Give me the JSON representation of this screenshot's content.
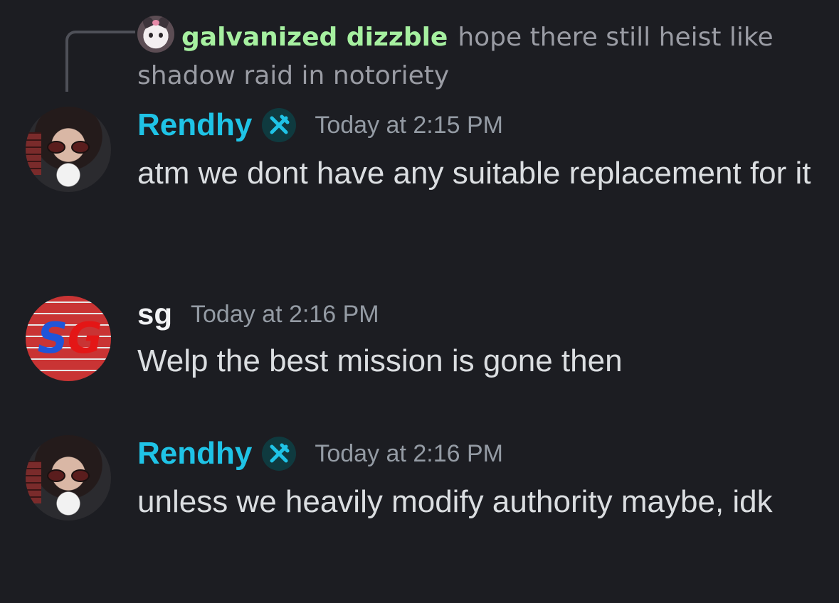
{
  "reply": {
    "username": "galvanized dizzble",
    "text": "hope there still heist like shadow raid in notoriety",
    "username_color": "#a6f0a0"
  },
  "messages": [
    {
      "username": "Rendhy",
      "timestamp": "Today at 2:15 PM",
      "text": "atm we dont have any suitable  replacement for it",
      "role_icon": "hammer-pick-icon",
      "username_color": "#1fc3e6"
    },
    {
      "username": "sg",
      "timestamp": "Today at 2:16 PM",
      "text": "Welp the best mission is gone then",
      "username_color": "#f2f3f5"
    },
    {
      "username": "Rendhy",
      "timestamp": "Today at 2:16 PM",
      "text": "unless we heavily modify authority maybe, idk",
      "role_icon": "hammer-pick-icon",
      "username_color": "#1fc3e6"
    }
  ],
  "colors": {
    "background": "#1c1d22",
    "text": "#dbdee1",
    "muted": "#949ba4",
    "role_accent": "#1fc3e6"
  }
}
